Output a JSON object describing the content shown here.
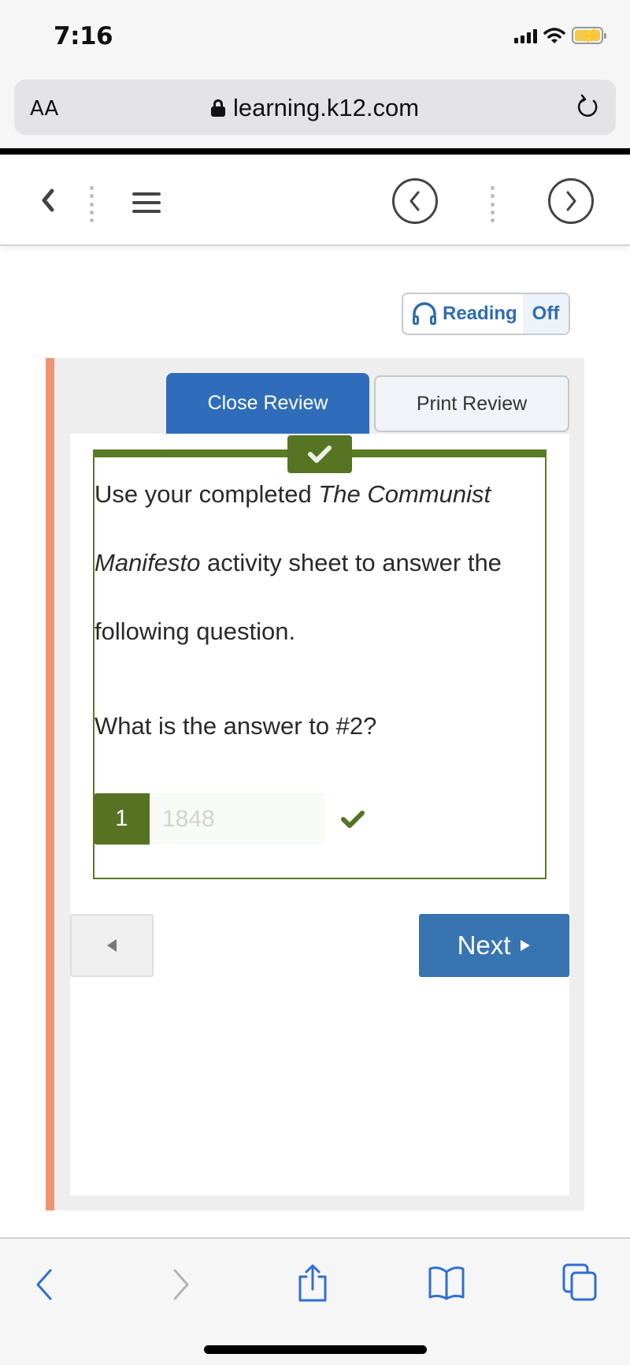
{
  "status_bar": {
    "time": "7:16",
    "icons": [
      "signal-icon",
      "wifi-icon",
      "battery-charging-icon"
    ]
  },
  "address_bar": {
    "text_size_label": "AA",
    "url": "learning.k12.com",
    "icons": [
      "lock-icon",
      "reload-icon"
    ]
  },
  "app_toolbar": {
    "icons": [
      "back-chevron-icon",
      "menu-icon",
      "previous-circle-icon",
      "next-circle-icon"
    ]
  },
  "reading_toggle": {
    "label": "Reading",
    "state": "Off",
    "icon": "headphones-icon"
  },
  "review_buttons": {
    "close_label": "Close Review",
    "print_label": "Print Review"
  },
  "colors": {
    "primary_blue": "#2f6dba",
    "correct_green": "#567424",
    "accent_orange": "#ee9474",
    "next_blue": "#3874b0"
  },
  "question": {
    "status": "correct",
    "line1_plain": "Use your completed ",
    "line1_italic": "The Communist",
    "line2_italic": "Manifesto",
    "line2_plain": " activity sheet to answer the",
    "line3": "following question.",
    "prompt": "What is the answer to #2?"
  },
  "answer": {
    "number": "1",
    "value": "1848",
    "result": "correct"
  },
  "navigation": {
    "next_label": "Next"
  },
  "safari_toolbar": {
    "icons": [
      "back-icon",
      "forward-icon",
      "share-icon",
      "bookmarks-icon",
      "tabs-icon"
    ]
  }
}
